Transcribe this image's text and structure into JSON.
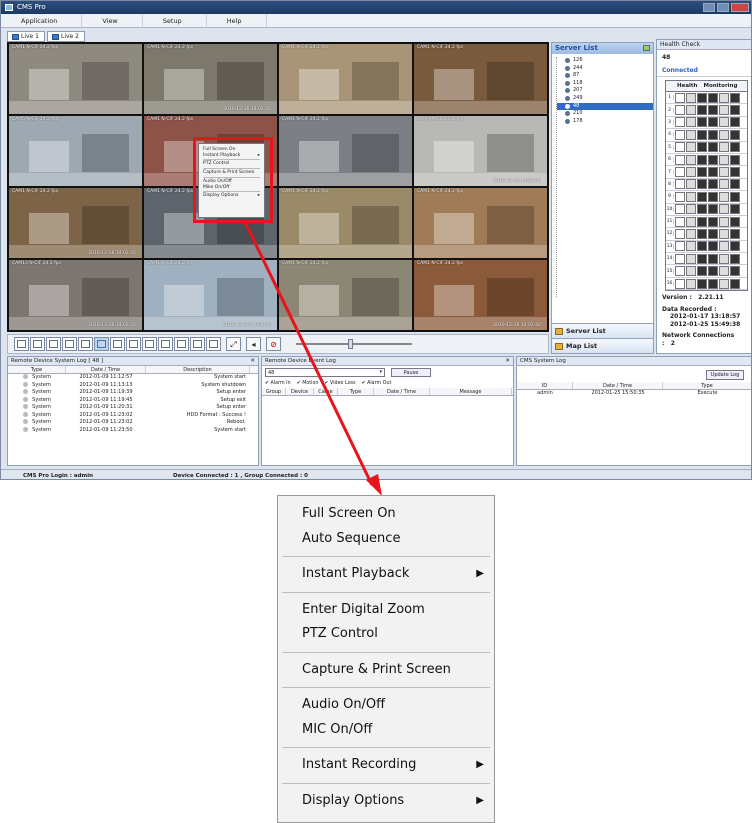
{
  "app": {
    "title": "CMS Pro",
    "menu": [
      "Application",
      "View",
      "Setup",
      "Help"
    ],
    "tabs": [
      "Live 1",
      "Live 2"
    ]
  },
  "cameras": [
    {
      "label": "CAM1 N-CIF 24.2 fps",
      "ts": "",
      "color": "#8f8a80"
    },
    {
      "label": "CAM1 N-CIF 24.2 fps",
      "ts": "2010-12-16  14:02:42",
      "color": "#7d786c"
    },
    {
      "label": "CAM1 N-CIF 24.2 fps",
      "ts": "",
      "color": "#a89577"
    },
    {
      "label": "CAM1 N-CIF 24.2 fps",
      "ts": "",
      "color": "#7a5a3c"
    },
    {
      "label": "CAM5 N-CIF 24.2 fps",
      "ts": "",
      "color": "#9da8b2"
    },
    {
      "label": "CAM1 N-CIF 24.2 fps",
      "ts": "",
      "color": "#8e5348"
    },
    {
      "label": "CAM1 N-CIF 24.2 fps",
      "ts": "",
      "color": "#7c7f85"
    },
    {
      "label": "CAM9 N-CIF 24.2 fps",
      "ts": "2010-12-16  14:02:42",
      "color": "#b8b9b6"
    },
    {
      "label": "CAM1 N-CIF 24.2 fps",
      "ts": "2010-12-16  14:02:42",
      "color": "#7e6446"
    },
    {
      "label": "CAM1 N-CIF 24.2 fps",
      "ts": "",
      "color": "#5d646c"
    },
    {
      "label": "CAM1 N-CIF 24.2 fps",
      "ts": "",
      "color": "#9a8a68"
    },
    {
      "label": "CAM1 N-CIF 24.2 fps",
      "ts": "",
      "color": "#a07b58"
    },
    {
      "label": "CAM13 N-CIF 24.2 fps",
      "ts": "2010-12-16  14:02:42",
      "color": "#7d7670"
    },
    {
      "label": "CAM1 N-CIF 24.2 fps",
      "ts": "2010-12-16  14:02:42",
      "color": "#9fb0c0"
    },
    {
      "label": "CAM1 N-CIF 24.2 fps",
      "ts": "",
      "color": "#8c8674"
    },
    {
      "label": "CAM1 N-CIF 24.2 fps",
      "ts": "2010-12-16  14:02:42",
      "color": "#8a5a3a"
    }
  ],
  "context_small": {
    "items": [
      "Full Screen On",
      "Instant Playback",
      "PTZ Control",
      "Capture & Print Screen",
      "Audio On/Off",
      "Mike On/Off",
      "Display Options"
    ]
  },
  "server_list": {
    "title": "Server List",
    "servers": [
      "126",
      "244",
      "87",
      "118",
      "207",
      "249",
      "48",
      "210",
      "178"
    ],
    "selected": "48",
    "bottom_tabs": [
      "Server List",
      "Map List"
    ]
  },
  "health": {
    "title": "Health Check",
    "device": "48",
    "status": "Connected",
    "col_health": "Health",
    "col_monitoring": "Monitoring",
    "version_label": "Version :",
    "version": "2.21.11",
    "recorded_label": "Data Recorded :",
    "recorded_from": "2012-01-17 13:18:57",
    "recorded_to": "2012-01-25 15:49:38",
    "network_label": "Network Connections :",
    "network": "2"
  },
  "system_log": {
    "title": "Remote Device System Log  [ 48 ]",
    "columns": [
      "Type",
      "Date / Time",
      "Description"
    ],
    "rows": [
      [
        "System",
        "2012-01-09 11:12:57",
        "System start"
      ],
      [
        "System",
        "2012-01-09 11:13:13",
        "System shutdown"
      ],
      [
        "System",
        "2012-01-09 11:19:39",
        "Setup enter"
      ],
      [
        "System",
        "2012-01-09 11:19:45",
        "Setup exit"
      ],
      [
        "System",
        "2012-01-09 11:20:31",
        "Setup enter"
      ],
      [
        "System",
        "2012-01-09 11:23:02",
        "HDD Format : Success !"
      ],
      [
        "System",
        "2012-01-09 11:23:02",
        "Reboot."
      ],
      [
        "System",
        "2012-01-09 11:23:50",
        "System start"
      ]
    ]
  },
  "event_log": {
    "title": "Remote Device Event Log",
    "device": "48",
    "pause": "Pause",
    "checks": [
      "Alarm In",
      "Motion",
      "Video Loss",
      "Alarm Out"
    ],
    "columns": [
      "Group",
      "Device",
      "Came",
      "Type",
      "Date / Time",
      "Message"
    ]
  },
  "cms_log": {
    "title": "CMS System Log",
    "update": "Update Log",
    "columns": [
      "ID",
      "Date / Time",
      "Type"
    ],
    "rows": [
      [
        "admin",
        "2012-01-25 15:50:35",
        "Execute"
      ]
    ]
  },
  "status": {
    "login": "CMS Pro Login : admin",
    "connected": "Device Connected : 1 , Group Connected : 0"
  },
  "context_menu": {
    "items": [
      {
        "label": "Full Screen On",
        "sub": false,
        "sep": false
      },
      {
        "label": "Auto Sequence",
        "sub": false,
        "sep": true
      },
      {
        "label": "Instant Playback",
        "sub": true,
        "sep": true
      },
      {
        "label": "Enter Digital Zoom",
        "sub": false,
        "sep": false
      },
      {
        "label": "PTZ Control",
        "sub": false,
        "sep": true
      },
      {
        "label": "Capture & Print Screen",
        "sub": false,
        "sep": true
      },
      {
        "label": "Audio On/Off",
        "sub": false,
        "sep": false
      },
      {
        "label": "MIC On/Off",
        "sub": false,
        "sep": true
      },
      {
        "label": "Instant Recording",
        "sub": true,
        "sep": true
      },
      {
        "label": "Display Options",
        "sub": true,
        "sep": false
      }
    ],
    "arrow_color": "#e8131b"
  }
}
